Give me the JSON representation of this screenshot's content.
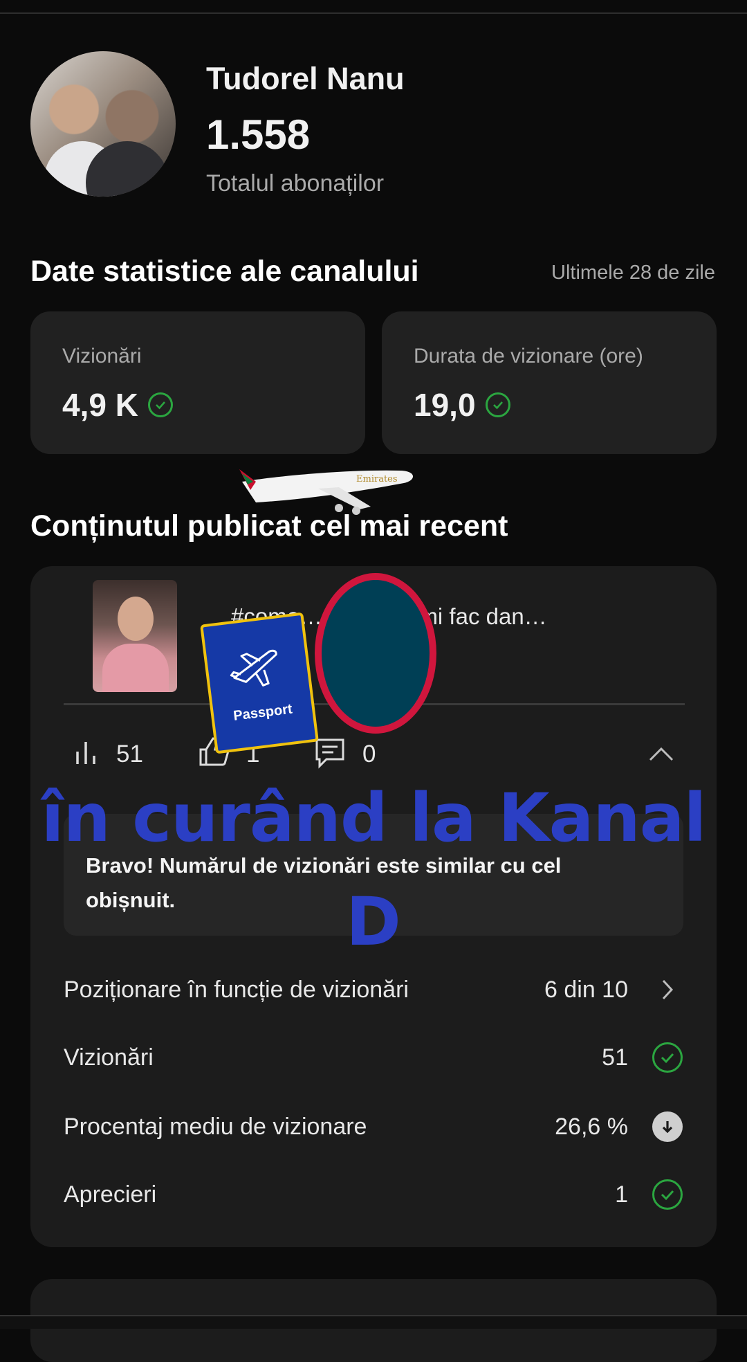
{
  "profile": {
    "name": "Tudorel Nanu",
    "subscribers": "1.558",
    "subscribers_label": "Totalul abonaților"
  },
  "channel_stats": {
    "title": "Date statistice ale canalului",
    "period": "Ultimele 28 de zile",
    "cards": [
      {
        "label": "Vizionări",
        "value": "4,9 K"
      },
      {
        "label": "Durata de vizionare (ore)",
        "value": "19,0"
      }
    ]
  },
  "recent": {
    "title": "Conținutul publicat cel mai recent",
    "video_title": "#come… ărbători îmi fac dan…",
    "metrics": {
      "views": "51",
      "likes": "1",
      "comments": "0"
    },
    "note": "Bravo! Numărul de vizionări este similar cu cel obișnuit.",
    "rows": [
      {
        "label": "Poziționare în funcție de vizionări",
        "value": "6 din 10"
      },
      {
        "label": "Vizionări",
        "value": "51"
      },
      {
        "label": "Procentaj mediu de vizionare",
        "value": "26,6 %"
      },
      {
        "label": "Aprecieri",
        "value": "1"
      }
    ]
  },
  "overlay": {
    "line1": "în curând la Kanal",
    "line2": "D",
    "passport_label": "Passport",
    "plane_livery": "Emirates"
  },
  "colors": {
    "accent_check": "#2ba640",
    "overlay_text": "#2b3fc4",
    "oval_border": "#d0163d",
    "oval_fill": "#003f55"
  }
}
